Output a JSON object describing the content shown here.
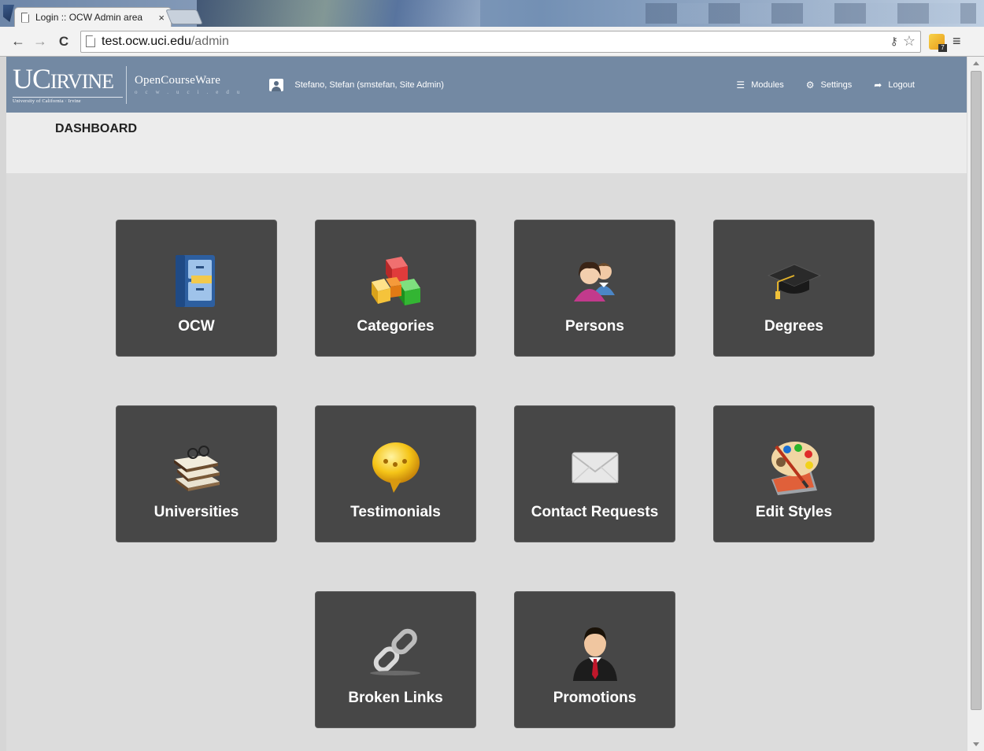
{
  "browser": {
    "tab_title": "Login :: OCW Admin area",
    "tab_close": "×",
    "url_host": "test.ocw.uci.edu",
    "url_path": "/admin",
    "ext_badge": "7"
  },
  "header": {
    "logo_uci_main": "UC",
    "logo_uci_main_small": "IRVINE",
    "logo_uci_sub": "University of California · Irvine",
    "logo_ocw_main": "OpenCourseWare",
    "logo_ocw_sub": "ocw.uci.edu",
    "user_label": "Stefano, Stefan (smstefan, Site Admin)",
    "nav": {
      "modules": "Modules",
      "settings": "Settings",
      "logout": "Logout"
    }
  },
  "page": {
    "heading": "DASHBOARD"
  },
  "tiles": [
    {
      "label": "OCW",
      "icon": "file-cabinet-icon"
    },
    {
      "label": "Categories",
      "icon": "colored-boxes-icon"
    },
    {
      "label": "Persons",
      "icon": "people-icon"
    },
    {
      "label": "Degrees",
      "icon": "graduation-cap-icon"
    },
    {
      "label": "Universities",
      "icon": "book-stack-icon"
    },
    {
      "label": "Testimonials",
      "icon": "speech-bubble-icon"
    },
    {
      "label": "Contact Requests",
      "icon": "envelope-icon"
    },
    {
      "label": "Edit Styles",
      "icon": "paint-palette-icon"
    },
    {
      "label": "Broken Links",
      "icon": "chain-link-icon"
    },
    {
      "label": "Promotions",
      "icon": "businessman-icon"
    }
  ]
}
